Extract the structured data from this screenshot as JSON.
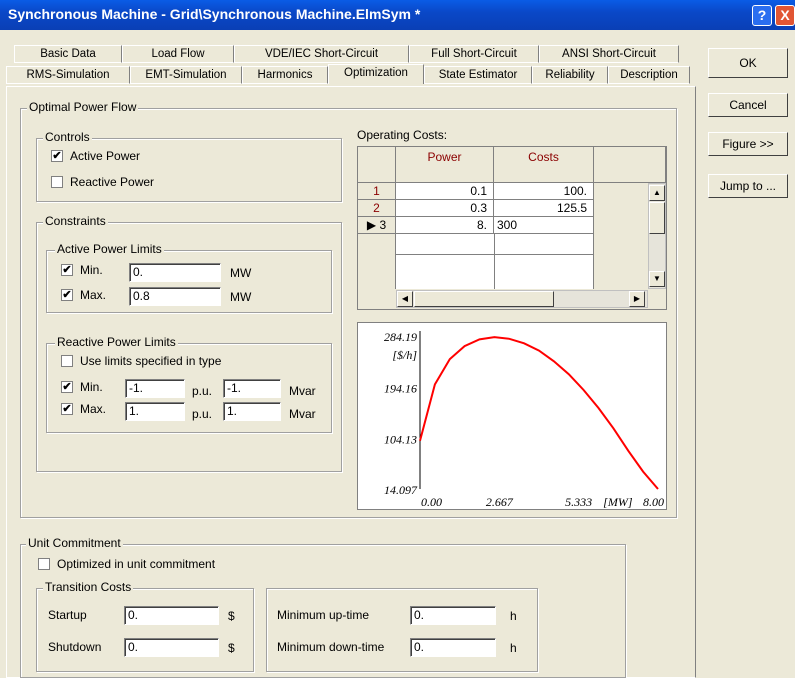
{
  "window": {
    "title": "Synchronous Machine - Grid\\Synchronous Machine.ElmSym *",
    "help": "?",
    "close": "X"
  },
  "tabs_row1": [
    "Basic Data",
    "Load Flow",
    "VDE/IEC Short-Circuit",
    "Full Short-Circuit",
    "ANSI Short-Circuit"
  ],
  "tabs_row2": [
    "RMS-Simulation",
    "EMT-Simulation",
    "Harmonics",
    "Optimization",
    "State Estimator",
    "Reliability",
    "Description"
  ],
  "active_tab": "Optimization",
  "buttons": {
    "ok": "OK",
    "cancel": "Cancel",
    "figure": "Figure >>",
    "jump": "Jump to ..."
  },
  "opf": {
    "title": "Optimal Power Flow",
    "controls": {
      "title": "Controls",
      "active_power": "Active Power",
      "active_checked": "✔",
      "reactive_power": "Reactive Power"
    },
    "constraints": {
      "title": "Constraints",
      "apl": {
        "title": "Active Power Limits",
        "min_label": "Min.",
        "min_value": "0.",
        "max_label": "Max.",
        "max_value": "0.8",
        "unit": "MW",
        "check": "✔"
      },
      "rpl": {
        "title": "Reactive Power Limits",
        "use_type": "Use limits specified in type",
        "min_label": "Min.",
        "min_pu": "-1.",
        "min_mvar": "-1.",
        "max_label": "Max.",
        "max_pu": "1.",
        "max_mvar": "1.",
        "pu": "p.u.",
        "mvar": "Mvar",
        "check": "✔"
      }
    },
    "operating_costs": {
      "title": "Operating Costs:",
      "headers": [
        "Power",
        "Costs"
      ],
      "rows": [
        {
          "n": "1",
          "power": "0.1",
          "cost": "100."
        },
        {
          "n": "2",
          "power": "0.3",
          "cost": "125.5"
        },
        {
          "n": "▶ 3",
          "power": "8.",
          "cost": "300"
        }
      ]
    }
  },
  "chart_data": {
    "type": "line",
    "ylabel": "[$/h]",
    "xlabel": "[MW]",
    "y_ticks": [
      "284.19",
      "194.16",
      "104.13",
      "14.097"
    ],
    "x_ticks": [
      "0.00",
      "2.667",
      "5.333",
      "8.00"
    ],
    "ylim": [
      14.097,
      284.19
    ],
    "xlim": [
      0,
      8
    ],
    "series": [
      {
        "color": "#ff0000",
        "x": [
          0,
          0.5,
          1,
          1.5,
          2,
          2.5,
          3,
          3.5,
          4,
          4.5,
          5,
          5.5,
          6,
          6.5,
          7,
          7.5,
          8
        ],
        "y": [
          100,
          200,
          245,
          268,
          280,
          284,
          281,
          273,
          260,
          241,
          218,
          190,
          158,
          122,
          82,
          45,
          14.1
        ]
      }
    ]
  },
  "unit_commitment": {
    "title": "Unit Commitment",
    "optimized": "Optimized in unit commitment",
    "transition": {
      "title": "Transition Costs",
      "startup": "Startup",
      "startup_val": "0.",
      "shutdown": "Shutdown",
      "shutdown_val": "0.",
      "unit": "$"
    },
    "min_up": "Minimum up-time",
    "min_up_val": "0.",
    "min_down": "Minimum down-time",
    "min_down_val": "0.",
    "unit": "h"
  }
}
